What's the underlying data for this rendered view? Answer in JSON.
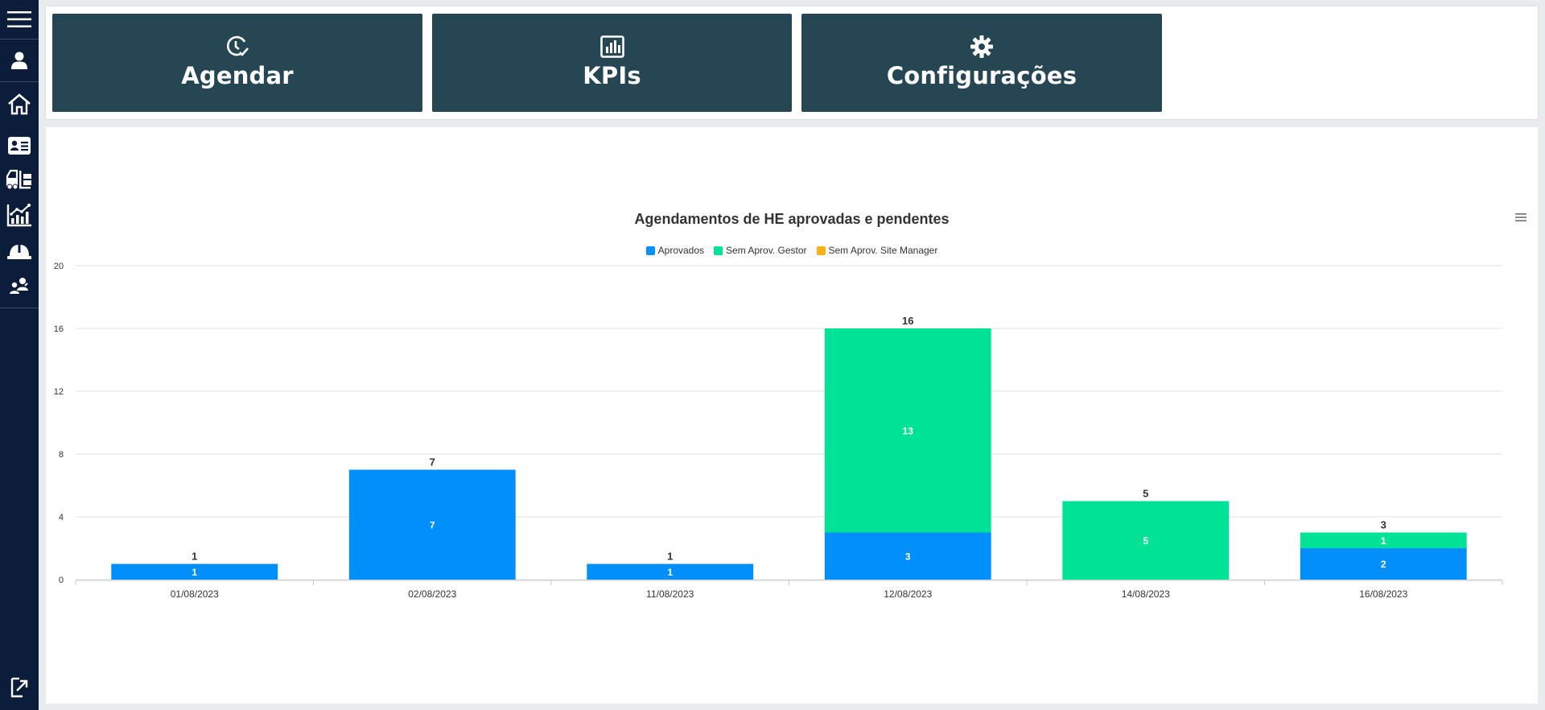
{
  "sidebar": {
    "items": [
      {
        "icon": "hamburger-menu-icon"
      },
      {
        "icon": "user-icon"
      },
      {
        "icon": "home-icon"
      },
      {
        "icon": "id-card-icon"
      },
      {
        "icon": "forklift-icon"
      },
      {
        "icon": "chart-line-icon"
      },
      {
        "icon": "hard-hat-icon"
      },
      {
        "icon": "people-icon"
      },
      {
        "icon": "logout-icon"
      }
    ]
  },
  "tiles": [
    {
      "label": "Agendar",
      "icon": "clock-check-icon"
    },
    {
      "label": "KPIs",
      "icon": "bar-chart-icon"
    },
    {
      "label": "Configurações",
      "icon": "gear-icon"
    }
  ],
  "colors": {
    "sidebar": "#0b1d3a",
    "tile": "#264653",
    "aprovados": "#008ffb",
    "sem_gestor": "#00e396",
    "sem_site": "#feb019"
  },
  "chart_data": {
    "type": "bar",
    "stacked": true,
    "title": "Agendamentos de HE aprovadas e pendentes",
    "legend_position": "top-center",
    "categories": [
      "01/08/2023",
      "02/08/2023",
      "11/08/2023",
      "12/08/2023",
      "14/08/2023",
      "16/08/2023"
    ],
    "series": [
      {
        "name": "Aprovados",
        "color": "#008ffb",
        "values": [
          1,
          7,
          1,
          3,
          0,
          2
        ]
      },
      {
        "name": "Sem Aprov. Gestor",
        "color": "#00e396",
        "values": [
          0,
          0,
          0,
          13,
          5,
          1
        ]
      },
      {
        "name": "Sem Aprov. Site Manager",
        "color": "#feb019",
        "values": [
          0,
          0,
          0,
          0,
          0,
          0
        ]
      }
    ],
    "totals": [
      1,
      7,
      1,
      16,
      5,
      3
    ],
    "yticks": [
      0,
      4,
      8,
      12,
      16,
      20
    ],
    "ylim": [
      0,
      20
    ],
    "grid": true
  }
}
